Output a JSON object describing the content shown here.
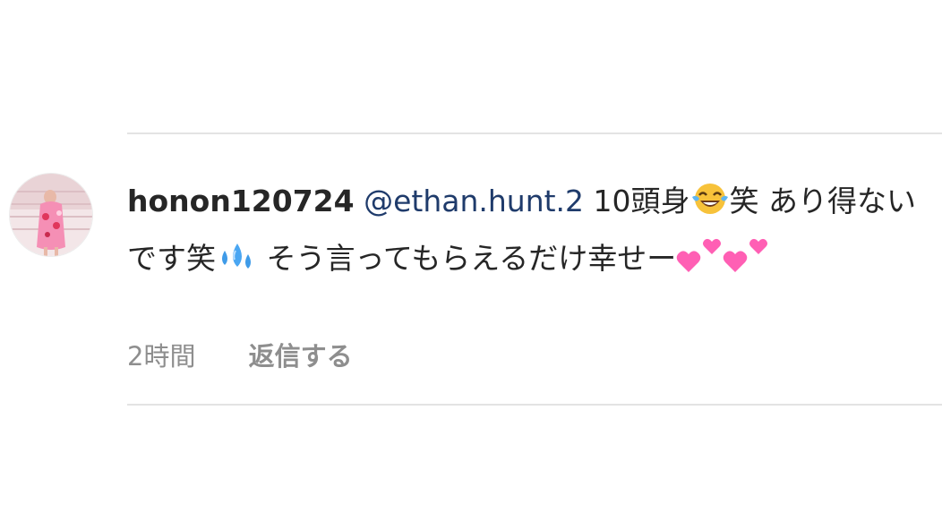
{
  "comment": {
    "username": "honon120724",
    "mention": "@ethan.hunt.2",
    "text_part1": " 10頭身",
    "text_part2": "笑 あり得ないです笑",
    "text_part3": "  そう言ってもらえるだけ幸せー",
    "emoji_laugh": "face-with-tears-of-joy-icon",
    "emoji_sweat": "sweat-droplets-icon",
    "emoji_hearts": "two-hearts-icon"
  },
  "meta": {
    "timestamp": "2時間",
    "reply_label": "返信する"
  },
  "colors": {
    "text": "#262626",
    "mention": "#1f3b6b",
    "meta": "#8e8e8e",
    "divider": "#e3e3e3",
    "heart": "#ff5fb4"
  }
}
